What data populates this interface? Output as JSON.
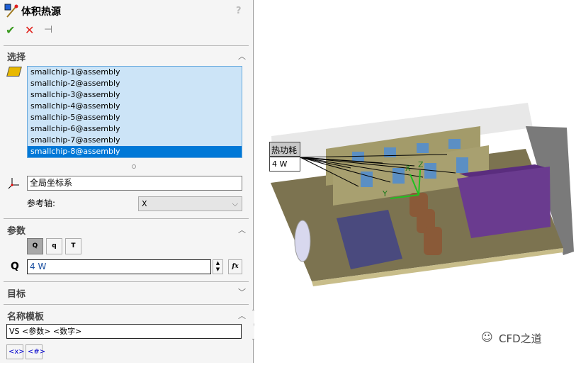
{
  "header": {
    "title": "体积热源",
    "help_icon": "?"
  },
  "actions": {
    "ok": "✔",
    "cancel": "✕",
    "pin": "⊣"
  },
  "selection": {
    "title": "选择",
    "items": [
      "smallchip-1@assembly",
      "smallchip-2@assembly",
      "smallchip-3@assembly",
      "smallchip-4@assembly",
      "smallchip-5@assembly",
      "smallchip-6@assembly",
      "smallchip-7@assembly",
      "smallchip-8@assembly"
    ],
    "selected_index": 7,
    "coordinate_system": "全局坐标系",
    "ref_axis_label": "参考轴:",
    "ref_axis_value": "X"
  },
  "parameters": {
    "title": "参数",
    "buttons": [
      "Q",
      "q",
      "T"
    ],
    "q_label": "Q",
    "q_value": "4 W",
    "fx": "fx"
  },
  "target": {
    "title": "目标"
  },
  "name_template": {
    "title": "名称模板",
    "value": "VS <参数> <数字>",
    "buttons": [
      "<x>",
      "<#>"
    ]
  },
  "viewport": {
    "callout_title": "热功耗",
    "callout_value": "4 W",
    "axis_x": "X",
    "axis_y": "Y",
    "axis_z": "Z",
    "watermark": "CFD之道"
  },
  "colors": {
    "accent": "#0078d7",
    "ok": "#3a9a1f",
    "cancel": "#e0201a"
  }
}
